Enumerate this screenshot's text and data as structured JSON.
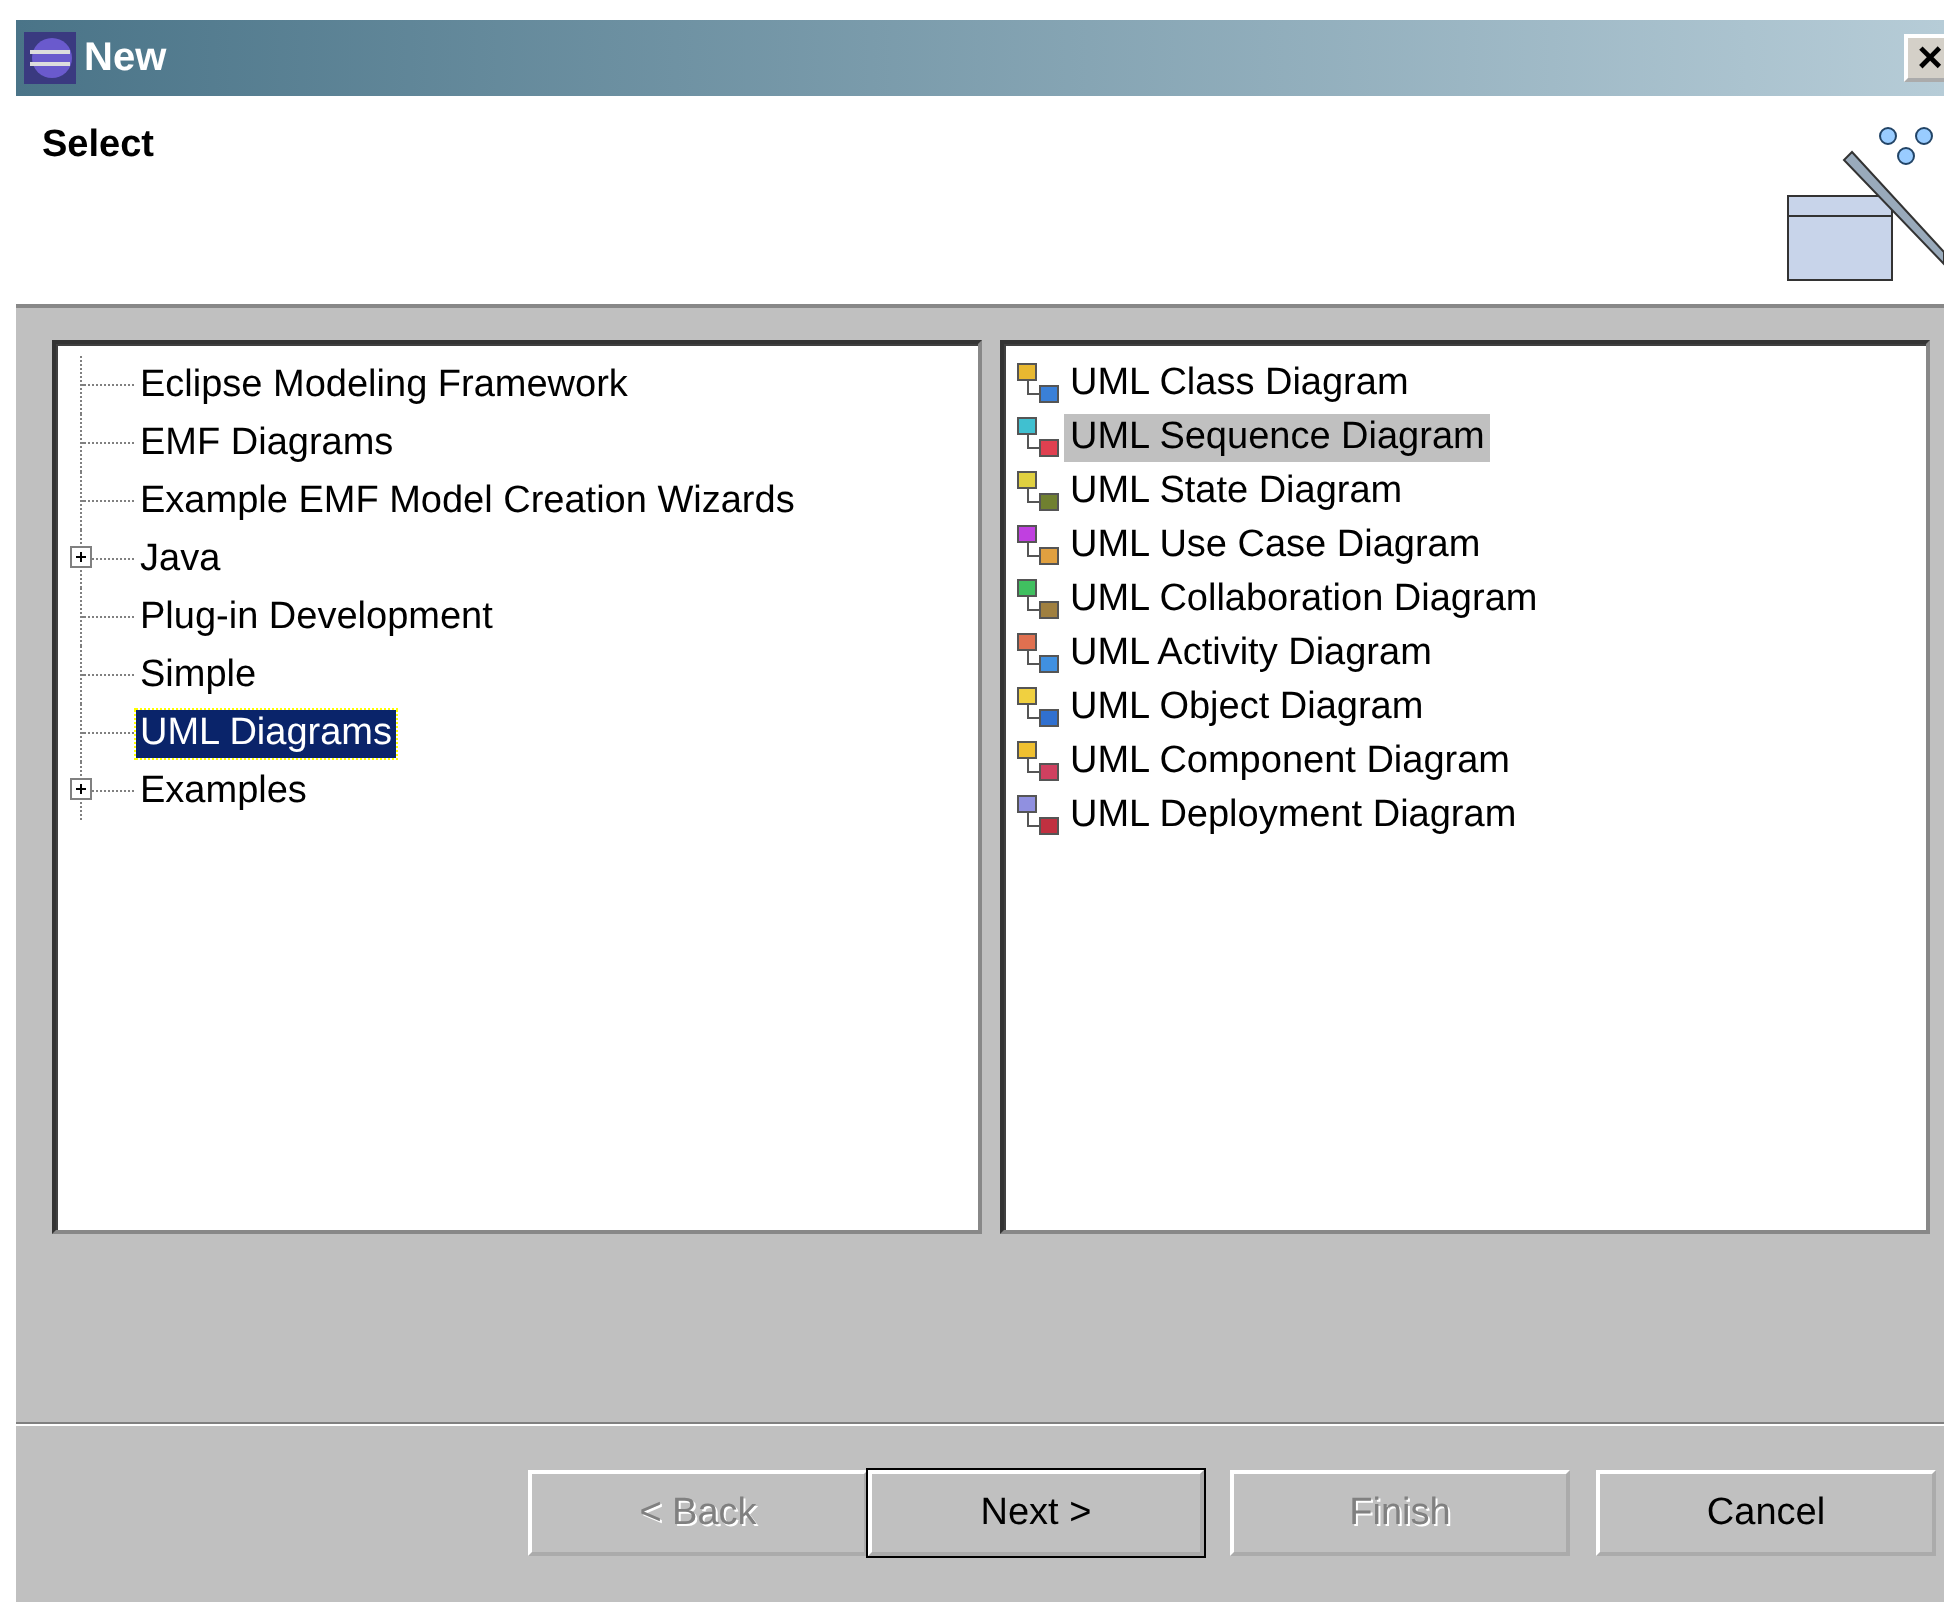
{
  "window": {
    "title": "New",
    "close": "×"
  },
  "header": {
    "title": "Select"
  },
  "wizards": [
    {
      "label": "Eclipse Modeling Framework",
      "kind": "leaf",
      "selected": false
    },
    {
      "label": "EMF Diagrams",
      "kind": "leaf",
      "selected": false
    },
    {
      "label": "Example EMF Model Creation Wizards",
      "kind": "leaf",
      "selected": false
    },
    {
      "label": "Java",
      "kind": "collapsed",
      "selected": false
    },
    {
      "label": "Plug-in Development",
      "kind": "leaf",
      "selected": false
    },
    {
      "label": "Simple",
      "kind": "leaf",
      "selected": false
    },
    {
      "label": "UML Diagrams",
      "kind": "leaf",
      "selected": true
    },
    {
      "label": "Examples",
      "kind": "collapsed",
      "selected": false
    }
  ],
  "diagrams": [
    {
      "label": "UML Class Diagram",
      "selected": false
    },
    {
      "label": "UML Sequence Diagram",
      "selected": true
    },
    {
      "label": "UML State Diagram",
      "selected": false
    },
    {
      "label": "UML Use Case Diagram",
      "selected": false
    },
    {
      "label": "UML Collaboration Diagram",
      "selected": false
    },
    {
      "label": "UML Activity Diagram",
      "selected": false
    },
    {
      "label": "UML Object Diagram",
      "selected": false
    },
    {
      "label": "UML Component Diagram",
      "selected": false
    },
    {
      "label": "UML Deployment Diagram",
      "selected": false
    }
  ],
  "buttons": [
    {
      "label": "< Back",
      "disabled": true,
      "default": false
    },
    {
      "label": "Next >",
      "disabled": false,
      "default": true
    },
    {
      "label": "Finish",
      "disabled": true,
      "default": false
    },
    {
      "label": "Cancel",
      "disabled": false,
      "default": false
    }
  ]
}
